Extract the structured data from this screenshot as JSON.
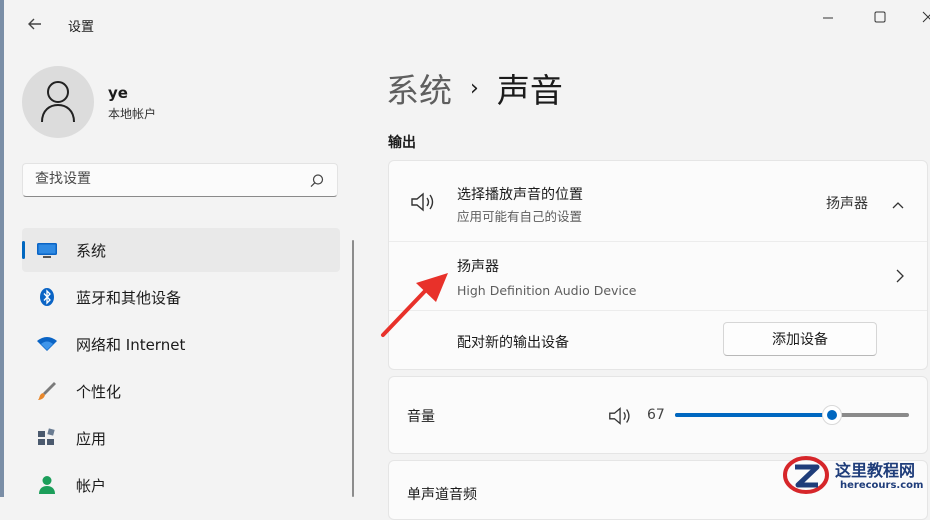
{
  "window": {
    "title": "设置",
    "back_icon": "back-arrow-icon",
    "controls": [
      "minimize-icon",
      "maximize-icon",
      "close-icon"
    ]
  },
  "user": {
    "name": "ye",
    "account_type": "本地帐户",
    "icon": "person-icon"
  },
  "search": {
    "placeholder": "查找设置",
    "icon": "search-icon"
  },
  "sidebar": {
    "items": [
      {
        "label": "系统",
        "icon": "monitor-icon",
        "selected": true
      },
      {
        "label": "蓝牙和其他设备",
        "icon": "bluetooth-icon"
      },
      {
        "label": "网络和 Internet",
        "icon": "wifi-icon"
      },
      {
        "label": "个性化",
        "icon": "brush-icon"
      },
      {
        "label": "应用",
        "icon": "apps-icon"
      },
      {
        "label": "帐户",
        "icon": "account-icon"
      }
    ]
  },
  "breadcrumb": {
    "parent": "系统",
    "separator": "›",
    "current": "声音"
  },
  "output": {
    "section_title": "输出",
    "choose": {
      "title": "选择播放声音的位置",
      "subtitle": "应用可能有自己的设置",
      "value": "扬声器",
      "icon": "speaker-icon"
    },
    "device": {
      "title": "扬声器",
      "subtitle": "High Definition Audio Device"
    },
    "pair": {
      "label": "配对新的输出设备",
      "button": "添加设备"
    }
  },
  "volume": {
    "label": "音量",
    "value": "67",
    "level_percent": 67,
    "icon": "speaker-icon"
  },
  "mono_audio": {
    "label": "单声道音频"
  },
  "watermark": {
    "title": "这里教程网",
    "url": "herecours.com"
  },
  "colors": {
    "accent": "#0067c0",
    "annotation_arrow": "#e8312a",
    "background": "#f3f3f3",
    "card": "#fbfbfb"
  }
}
